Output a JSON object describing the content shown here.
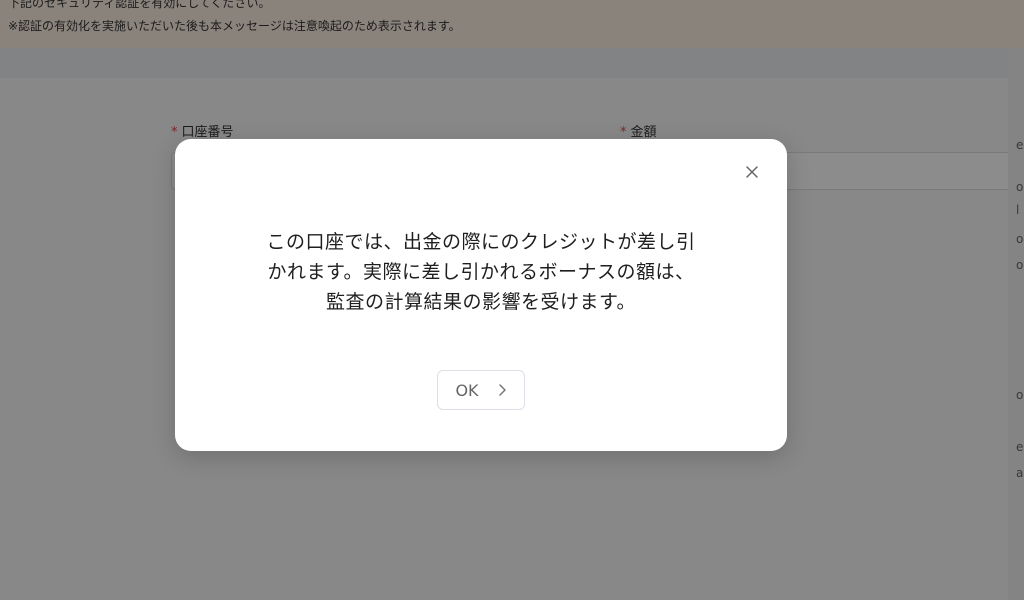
{
  "notice": {
    "line1": "下記のセキュリティ認証を有効にしてください。",
    "line2": "※認証の有効化を実施いただいた後も本メッセージは注意喚起のため表示されます。"
  },
  "form": {
    "account_label": "口座番号",
    "amount_label": "金額",
    "required_mark": "*"
  },
  "side_glyphs": [
    "e",
    "o",
    "l",
    "o",
    "o",
    "e",
    "o",
    "a"
  ],
  "dialog": {
    "message": "この口座では、出金の際にのクレジットが差し引かれます。実際に差し引かれるボーナスの額は、監査の計算結果の影響を受けます。",
    "ok_label": "OK",
    "close_icon": "close-icon",
    "ok_icon": "chevron-right-icon"
  },
  "colors": {
    "notice_bg": "#fcefe2",
    "required": "#e5484d",
    "overlay": "rgba(0,0,0,0.45)"
  }
}
